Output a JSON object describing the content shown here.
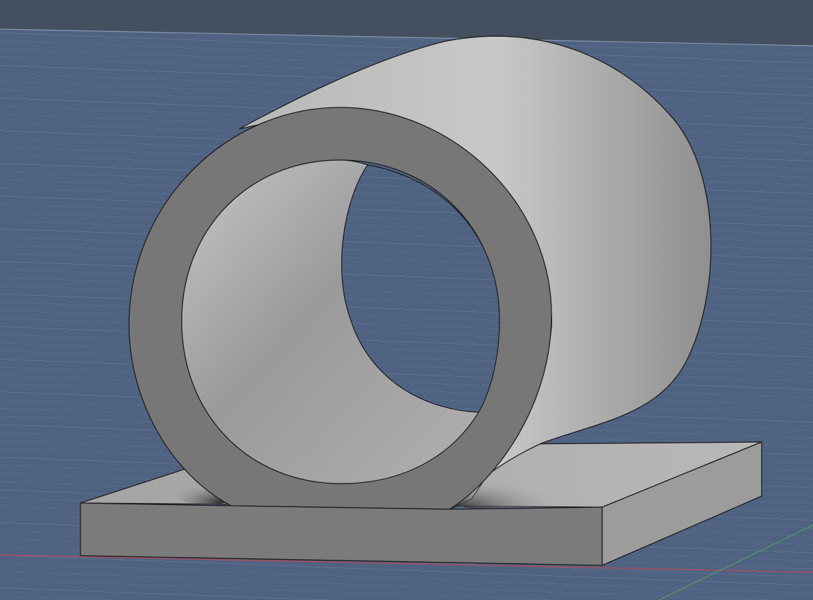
{
  "viewport": {
    "view_mode": "perspective",
    "display_style": "shaded",
    "background_color": "#44505f",
    "ground_plane_color": "#4f6180",
    "grid_line_color": "#8ea0bd",
    "x_axis_color": "#b04d5b",
    "y_axis_color": "#4f9a6a"
  },
  "model": {
    "shape": "pipe-clamp-bracket",
    "parts": [
      "base-plate",
      "tube-ring",
      "tube-body"
    ],
    "face_color": "#777777",
    "light_face_color": "#c3c3c3",
    "edge_color": "#1a1a1a"
  }
}
